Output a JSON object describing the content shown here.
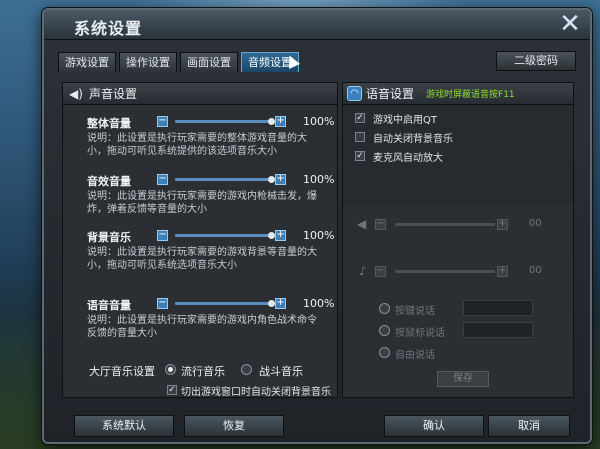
{
  "window": {
    "title": "系统设置",
    "close_glyph": "✕"
  },
  "tabs": [
    {
      "label": "游戏设置",
      "active": false
    },
    {
      "label": "操作设置",
      "active": false
    },
    {
      "label": "画面设置",
      "active": false
    },
    {
      "label": "音频设置",
      "active": true
    }
  ],
  "secondary_password_label": "二级密码",
  "sound": {
    "header": "声音设置",
    "items": [
      {
        "label": "整体音量",
        "value_percent": 100,
        "value_text": "100%",
        "desc": "说明：此设置是执行玩家需要的整体游戏音量的大小，拖动可听见系统提供的该选项音乐大小"
      },
      {
        "label": "音效音量",
        "value_percent": 100,
        "value_text": "100%",
        "desc": "说明：此设置是执行玩家需要的游戏内枪械击发，爆炸，弹着反馈等音量的大小"
      },
      {
        "label": "背景音乐",
        "value_percent": 100,
        "value_text": "100%",
        "desc": "说明：此设置是执行玩家需要的游戏背景等音量的大小，拖动可听见系统选项音乐大小"
      },
      {
        "label": "语音音量",
        "value_percent": 100,
        "value_text": "100%",
        "desc": "说明：此设置是执行玩家需要的游戏内角色战术命令反馈的音量大小"
      }
    ],
    "lobby_music": {
      "label": "大厅音乐设置",
      "options": [
        {
          "label": "流行音乐",
          "selected": true
        },
        {
          "label": "战斗音乐",
          "selected": false
        }
      ]
    },
    "auto_close_bg": {
      "label": "切出游戏窗口时自动关闭背景音乐",
      "checked": true
    }
  },
  "voice": {
    "header": "语音设置",
    "hint": "游戏时屏蔽语音按F11",
    "options": [
      {
        "label": "游戏中启用QT",
        "checked": true
      },
      {
        "label": "自动关闭背景音乐",
        "checked": false
      },
      {
        "label": "麦克风自动放大",
        "checked": true
      }
    ],
    "speaker_value": "00",
    "mic_value": "00",
    "talk_modes": [
      "按键说话",
      "按鼠标说话",
      "自由说话"
    ],
    "save_label": "保存"
  },
  "footer": {
    "default": "系统默认",
    "restore": "恢复",
    "ok": "确认",
    "cancel": "取消"
  },
  "colors": {
    "accent": "#3f7fb8",
    "hint_green": "#8fdc34"
  }
}
